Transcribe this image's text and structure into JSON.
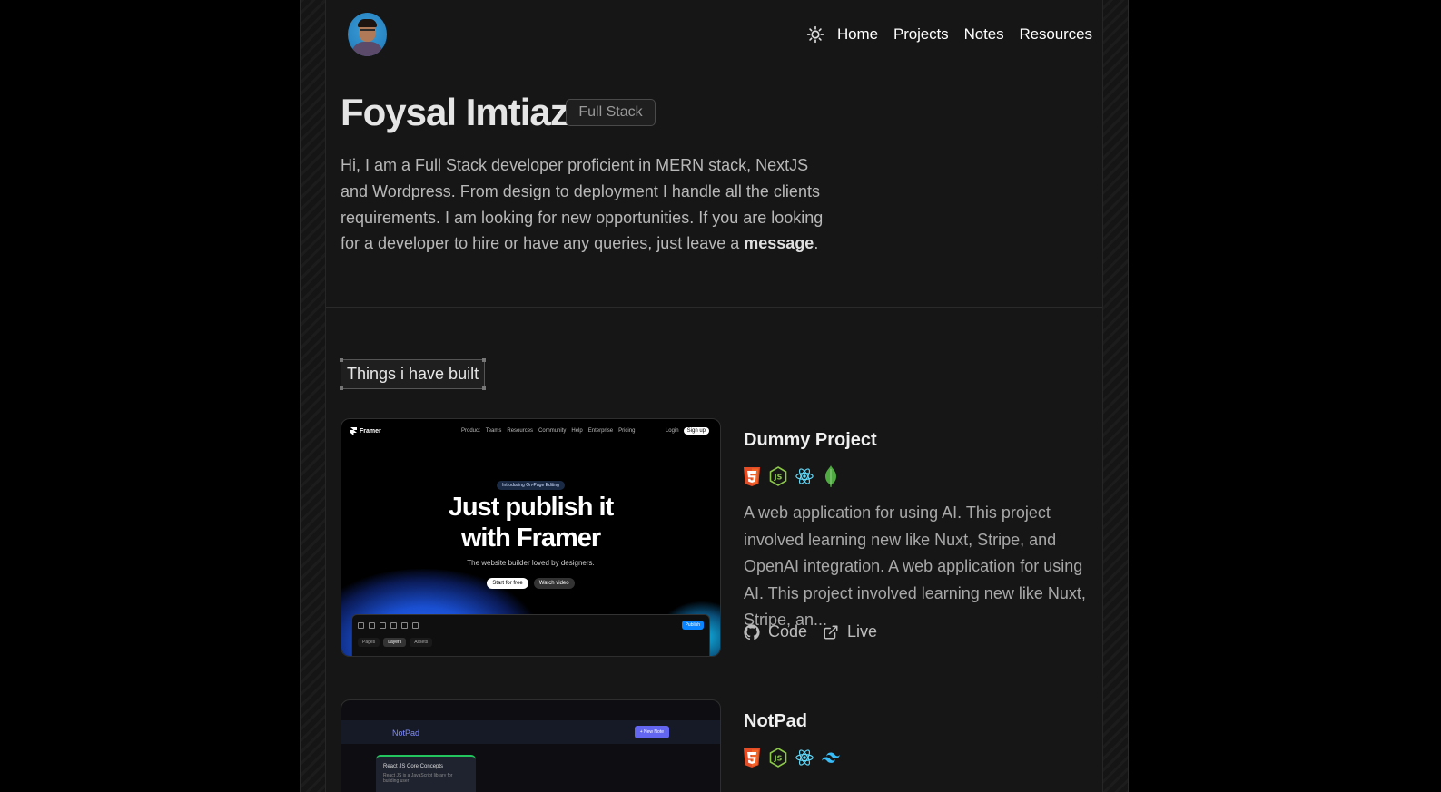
{
  "profile": {
    "name": "Foysal Imtiaz",
    "role": "Full Stack",
    "bio_text": "Hi, I am a Full Stack developer proficient in MERN stack, NextJS and Wordpress. From design to deployment I handle all the clients requirements. I am looking for new opportunities. If you are looking for a developer to hire or have any queries, just leave a ",
    "bio_link": "message",
    "bio_end": "."
  },
  "nav": {
    "theme_icon": "sun-icon",
    "items": [
      "Home",
      "Projects",
      "Notes",
      "Resources"
    ]
  },
  "section": {
    "title": "Things i have built"
  },
  "projects": [
    {
      "title": "Dummy Project",
      "tech_icons": [
        "html5-icon",
        "nodejs-icon",
        "react-icon",
        "mongodb-icon"
      ],
      "description": "A web application for using AI. This project involved learning new like Nuxt, Stripe, and OpenAI integration. A web application for using AI. This project involved learning new like Nuxt, Stripe, an...",
      "code_label": "Code",
      "live_label": "Live",
      "preview": {
        "brand": "Framer",
        "nav_links": [
          "Product",
          "Teams",
          "Resources",
          "Community",
          "Help",
          "Enterprise",
          "Pricing"
        ],
        "login": "Login",
        "signup": "Sign up",
        "badge": "Introducing On-Page Editing",
        "headline_1": "Just publish it",
        "headline_2": "with Framer",
        "subtitle": "The website builder loved by designers.",
        "btn_primary": "Start for free",
        "btn_secondary": "Watch video",
        "publish": "Publish",
        "tabs": [
          "Pages",
          "Layers",
          "Assets"
        ]
      }
    },
    {
      "title": "NotPad",
      "tech_icons": [
        "html5-icon",
        "nodejs-icon",
        "react-icon",
        "tailwind-icon"
      ],
      "preview": {
        "app_title": "NotPad",
        "new_button": "+ New Note",
        "card_title": "React JS Core Concepts",
        "card_desc": "React JS is a JavaScript library for building user"
      }
    }
  ],
  "colors": {
    "background": "#000000",
    "panel": "#161616",
    "html5": "#e44d26",
    "nodejs": "#8cc84b",
    "react": "#61dafb",
    "mongodb": "#4faa41",
    "tailwind": "#38bdf8"
  }
}
